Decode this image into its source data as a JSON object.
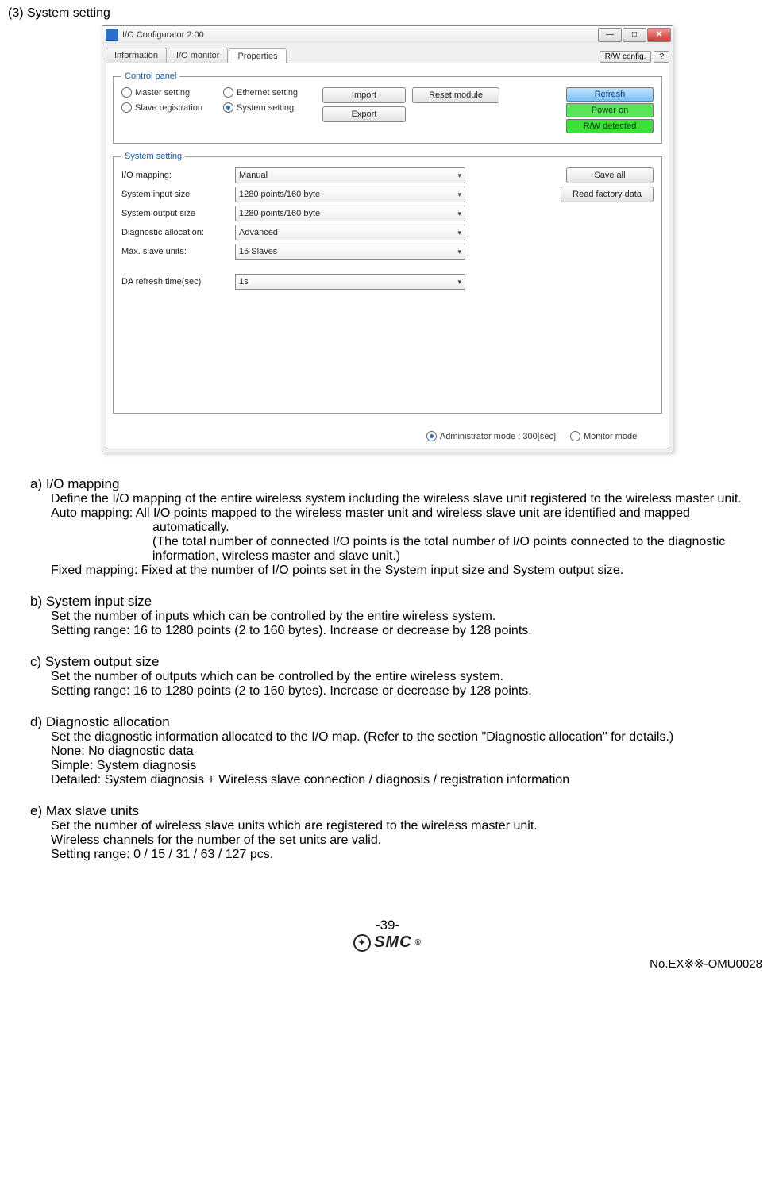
{
  "section_title": "(3) System setting",
  "window": {
    "title": "I/O Configurator 2.00",
    "tabs": [
      "Information",
      "I/O monitor",
      "Properties"
    ],
    "active_tab": 2,
    "rw_config_btn": "R/W config.",
    "help_btn": "?"
  },
  "control_panel": {
    "legend": "Control panel",
    "radios": {
      "master": "Master setting",
      "ethernet": "Ethernet setting",
      "slave": "Slave registration",
      "system": "System setting"
    },
    "selected": "system",
    "buttons": {
      "import": "Import",
      "export": "Export",
      "reset": "Reset module"
    },
    "status": {
      "refresh": "Refresh",
      "power": "Power on",
      "rw": "R/W detected"
    }
  },
  "system_setting": {
    "legend": "System setting",
    "rows": {
      "io_mapping": {
        "label": "I/O mapping:",
        "value": "Manual"
      },
      "sys_in": {
        "label": "System input size",
        "value": "1280 points/160 byte"
      },
      "sys_out": {
        "label": "System output size",
        "value": "1280 points/160 byte"
      },
      "diag": {
        "label": "Diagnostic allocation:",
        "value": "Advanced"
      },
      "max_slave": {
        "label": "Max. slave units:",
        "value": "15 Slaves"
      },
      "da_refresh": {
        "label": "DA refresh time(sec)",
        "value": "1s"
      }
    },
    "buttons": {
      "save_all": "Save all",
      "read_factory": "Read factory data"
    }
  },
  "mode_bar": {
    "admin": "Administrator mode : 300[sec]",
    "monitor": "Monitor mode"
  },
  "descriptions": {
    "a_title": "a) I/O mapping",
    "a_p1": "Define the I/O mapping of the entire wireless system including the wireless slave unit registered to the wireless master unit.",
    "a_auto": "Auto mapping: All I/O points mapped to the wireless master unit and wireless slave unit are identified and mapped automatically.",
    "a_auto2": "(The total number of connected I/O points is the total number of I/O points connected to the diagnostic information, wireless master and slave unit.)",
    "a_fixed": "Fixed mapping: Fixed at the number of I/O points set in the System input size and System output size.",
    "b_title": "b) System input size",
    "b_p1": "Set the number of inputs which can be controlled by the entire wireless system.",
    "b_p2": "Setting range: 16 to 1280 points (2 to 160 bytes). Increase or decrease by 128 points.",
    "c_title": "c) System output size",
    "c_p1": "Set the number of outputs which can be controlled by the entire wireless system.",
    "c_p2": "Setting range: 16 to 1280 points (2 to 160 bytes). Increase or decrease by 128 points.",
    "d_title": "d) Diagnostic allocation",
    "d_p1": "Set the diagnostic information allocated to the I/O map. (Refer to the section \"Diagnostic allocation\" for details.)",
    "d_p2": "None: No diagnostic data",
    "d_p3": "Simple: System diagnosis",
    "d_p4": "Detailed: System diagnosis + Wireless slave connection / diagnosis / registration information",
    "e_title": "e) Max slave units",
    "e_p1": "Set the number of wireless slave units which are registered to the wireless master unit.",
    "e_p2": "Wireless channels for the number of the set units are valid.",
    "e_p3": "Setting range: 0 / 15 / 31 / 63 / 127 pcs."
  },
  "footer": {
    "page": "-39-",
    "logo": "SMC",
    "docnum": "No.EX※※-OMU0028"
  }
}
